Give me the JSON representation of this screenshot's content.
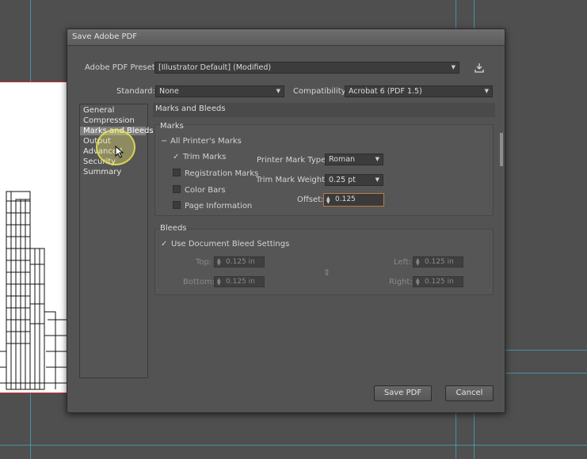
{
  "dialog": {
    "title": "Save Adobe PDF",
    "preset_label": "Adobe PDF Preset:",
    "preset_value": "[Illustrator Default] (Modified)",
    "standard_label": "Standard:",
    "standard_value": "None",
    "compat_label": "Compatibility:",
    "compat_value": "Acrobat 6 (PDF 1.5)"
  },
  "nav": {
    "items": [
      "General",
      "Compression",
      "Marks and Bleeds",
      "Output",
      "Advanced",
      "Security",
      "Summary"
    ],
    "selected": "Marks and Bleeds"
  },
  "panel": {
    "title": "Marks and Bleeds",
    "marks": {
      "legend": "Marks",
      "all_printers_marks": "All Printer's Marks",
      "trim_marks": "Trim Marks",
      "registration_marks": "Registration Marks",
      "color_bars": "Color Bars",
      "page_information": "Page Information",
      "printer_mark_type_label": "Printer Mark Type:",
      "printer_mark_type_value": "Roman",
      "trim_mark_weight_label": "Trim Mark Weight:",
      "trim_mark_weight_value": "0.25 pt",
      "offset_label": "Offset:",
      "offset_value": "0.125"
    },
    "bleeds": {
      "legend": "Bleeds",
      "use_doc_bleed": "Use Document Bleed Settings",
      "top_label": "Top:",
      "top_value": "0.125 in",
      "bottom_label": "Bottom:",
      "bottom_value": "0.125 in",
      "left_label": "Left:",
      "left_value": "0.125 in",
      "right_label": "Right:",
      "right_value": "0.125 in"
    }
  },
  "buttons": {
    "save": "Save PDF",
    "cancel": "Cancel"
  },
  "checks": {
    "trim_marks": true,
    "registration_marks": false,
    "color_bars": false,
    "page_information": false,
    "use_doc_bleed": true
  },
  "colors": {
    "dialog_bg": "#535353",
    "guide": "#45a5c4",
    "highlight": "#f5f074"
  }
}
